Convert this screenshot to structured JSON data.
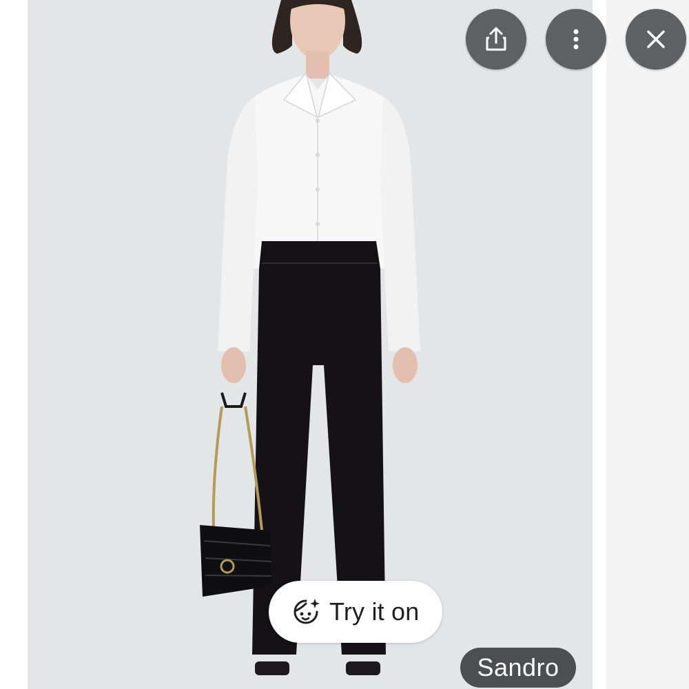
{
  "viewer": {
    "product_image": {
      "description_icon": "fashion-model-photo",
      "colors": {
        "background": "#e4e5e7",
        "shirt": "#f7f7f8",
        "trousers": "#141216",
        "bag": "#0f0e10"
      }
    },
    "actions": {
      "share_icon": "share-icon",
      "more_icon": "more-vert-icon",
      "close_icon": "close-icon"
    },
    "try_on": {
      "icon": "try-on-face-sparkle-icon",
      "label": "Try it on"
    },
    "source": {
      "label": "Sandro"
    }
  },
  "colors": {
    "control_bg": "#5f6062",
    "badge_bg": "#4d4e50",
    "pill_bg": "#ffffff",
    "pill_text": "#1f1f1f"
  }
}
